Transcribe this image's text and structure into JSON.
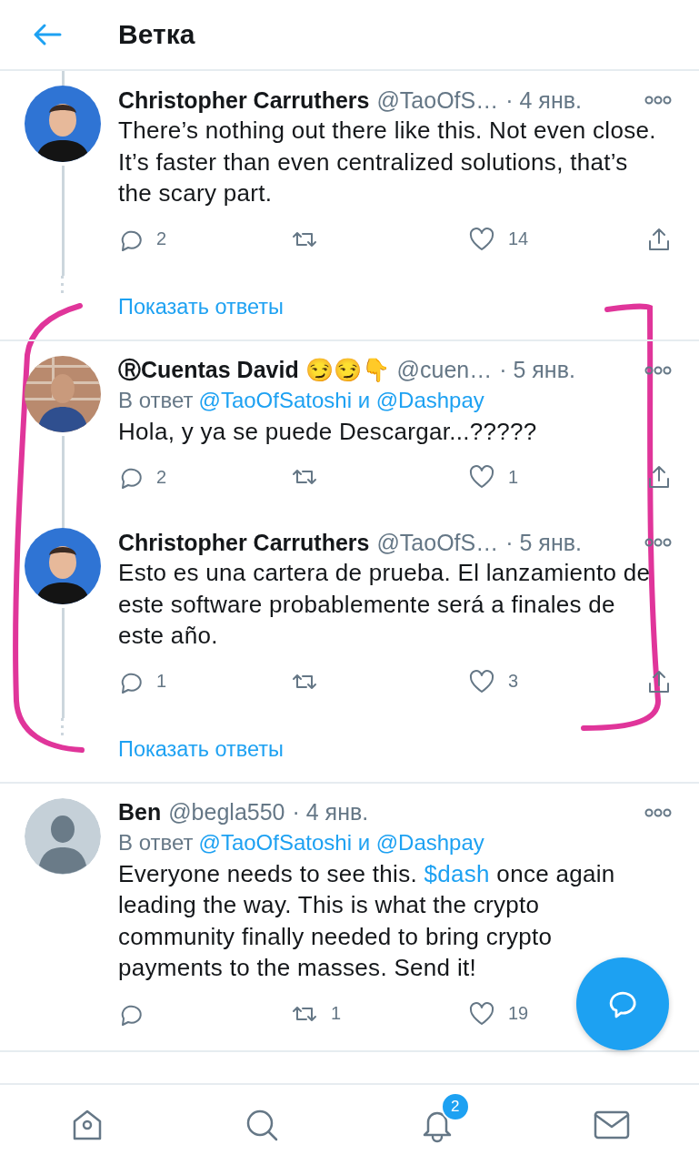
{
  "header": {
    "title": "Ветка"
  },
  "groups": [
    {
      "continues_above": true,
      "show_replies": "Показать ответы",
      "tweets": [
        {
          "avatar": {
            "kind": "picture"
          },
          "name": "Christopher Carruthers",
          "handle": "@TaoOfS…",
          "date": "· 4 янв.",
          "text_parts": [
            {
              "kind": "plain",
              "text": "There’s nothing out there like this. Not even close. It’s faster than even centralized solutions, that’s the scary part."
            }
          ],
          "replies": "2",
          "likes": "14",
          "share": true
        }
      ]
    },
    {
      "continues_above": false,
      "show_replies": "Показать ответы",
      "tweets": [
        {
          "avatar": {
            "kind": "picture"
          },
          "name": "ⓇCuentas David 😏😏👇",
          "handle": "@cuen…",
          "date": "· 5 янв.",
          "reply_to": {
            "label": "В ответ",
            "users": "@TaoOfSatoshi и @Dashpay"
          },
          "text_parts": [
            {
              "kind": "plain",
              "text": "Hola,  y ya se puede Descargar...?????"
            }
          ],
          "replies": "2",
          "likes": "1",
          "share": true
        },
        {
          "avatar": {
            "kind": "picture"
          },
          "name": "Christopher Carruthers",
          "handle": "@TaoOfS…",
          "date": "· 5 янв.",
          "text_parts": [
            {
              "kind": "plain",
              "text": "Esto es una cartera de prueba. El lanzamiento de este software probablemente será a finales de este año."
            }
          ],
          "replies": "1",
          "likes": "3",
          "share": true
        }
      ]
    },
    {
      "continues_above": false,
      "tweets": [
        {
          "avatar": {
            "kind": "default"
          },
          "name": "Ben",
          "handle": "@begla550",
          "date": "· 4 янв.",
          "reply_to": {
            "label": "В ответ",
            "users": "@TaoOfSatoshi и @Dashpay"
          },
          "text_parts": [
            {
              "kind": "plain",
              "text": "Everyone needs to see this. "
            },
            {
              "kind": "link",
              "text": "$dash"
            },
            {
              "kind": "plain",
              "text": " once again leading the way. This is what the crypto community finally needed to bring crypto payments to the masses. Send it!"
            }
          ],
          "retweets": "1",
          "likes": "19"
        }
      ]
    }
  ],
  "annotations": [
    {
      "kind": "bracket-pair"
    }
  ],
  "tab_bar": [
    {
      "kind": "home"
    },
    {
      "kind": "search"
    },
    {
      "kind": "notifications",
      "badge": "2"
    },
    {
      "kind": "messages"
    }
  ]
}
